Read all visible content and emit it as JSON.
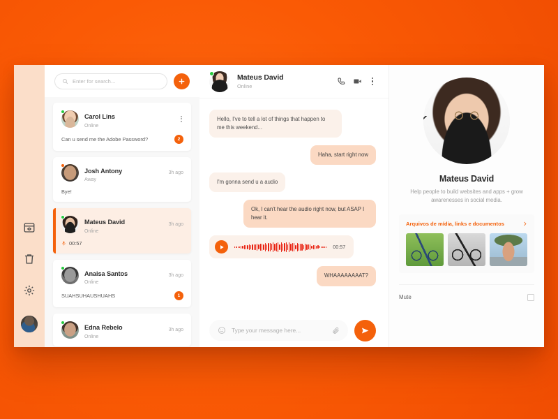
{
  "theme": {
    "accent": "#f4610b",
    "backdrop": "#fa5a05",
    "rail_bg": "#fbdec9",
    "online": "#27c93f",
    "away": "#f4610b"
  },
  "rail": {
    "items": [
      {
        "name": "archive",
        "icon": "archive-icon"
      },
      {
        "name": "trash",
        "icon": "trash-icon"
      },
      {
        "name": "settings",
        "icon": "gear-icon"
      },
      {
        "name": "profile",
        "icon": "avatar"
      }
    ]
  },
  "search": {
    "placeholder": "Enter for search...",
    "value": "",
    "add_label": "+"
  },
  "chat_list": [
    {
      "name": "Carol Lins",
      "status": "Online",
      "presence": "online",
      "time": "",
      "preview": "Can u send me the Adobe Password?",
      "badge": "2",
      "has_menu": true,
      "active": false,
      "type": "text"
    },
    {
      "name": "Josh Antony",
      "status": "Away",
      "presence": "away",
      "time": "3h ago",
      "preview": "Bye!",
      "badge": "",
      "has_menu": false,
      "active": false,
      "type": "text"
    },
    {
      "name": "Mateus David",
      "status": "Online",
      "presence": "online",
      "time": "3h ago",
      "preview": "",
      "audio_time": "00:57",
      "badge": "",
      "has_menu": false,
      "active": true,
      "type": "audio"
    },
    {
      "name": "Anaisa Santos",
      "status": "Online",
      "presence": "online",
      "time": "3h ago",
      "preview": "SUAHSUHAUSHUAHS",
      "badge": "1",
      "has_menu": false,
      "active": false,
      "type": "text"
    },
    {
      "name": "Edna Rebelo",
      "status": "Online",
      "presence": "online",
      "time": "3h ago",
      "preview": "",
      "badge": "",
      "has_menu": false,
      "active": false,
      "type": "text"
    }
  ],
  "conversation": {
    "header": {
      "name": "Mateus David",
      "status": "Online",
      "presence": "online"
    },
    "actions": [
      {
        "name": "call-button",
        "icon": "phone-icon"
      },
      {
        "name": "video-call-button",
        "icon": "video-icon"
      },
      {
        "name": "conversation-menu-button",
        "icon": "more-vertical-icon"
      }
    ],
    "messages": [
      {
        "dir": "in",
        "type": "text",
        "text": "Hello, I've to tell a lot of things that happen to me this weekend..."
      },
      {
        "dir": "out",
        "type": "text",
        "text": "Haha, start right now"
      },
      {
        "dir": "in",
        "type": "text",
        "text": "I'm gonna send u a audio"
      },
      {
        "dir": "out",
        "type": "text",
        "text": "Ok, I can't hear the audio right now, but ASAP I hear it."
      },
      {
        "dir": "in",
        "type": "audio",
        "duration": "00:57"
      },
      {
        "dir": "out",
        "type": "text",
        "text": "WHAAAAAAAAT?"
      }
    ],
    "composer": {
      "placeholder": "Type your message here...",
      "value": ""
    }
  },
  "profile": {
    "name": "Mateus David",
    "bio": "Help people to build websites and apps + grow awarenesses in social media.",
    "media_title": "Arquivos de mídia, links e documentos",
    "thumbs": [
      {
        "alt": "bicycle-on-grass"
      },
      {
        "alt": "bicycle-on-pavement"
      },
      {
        "alt": "cyclist-on-street"
      }
    ],
    "mute_label": "Mute",
    "mute_checked": false
  }
}
